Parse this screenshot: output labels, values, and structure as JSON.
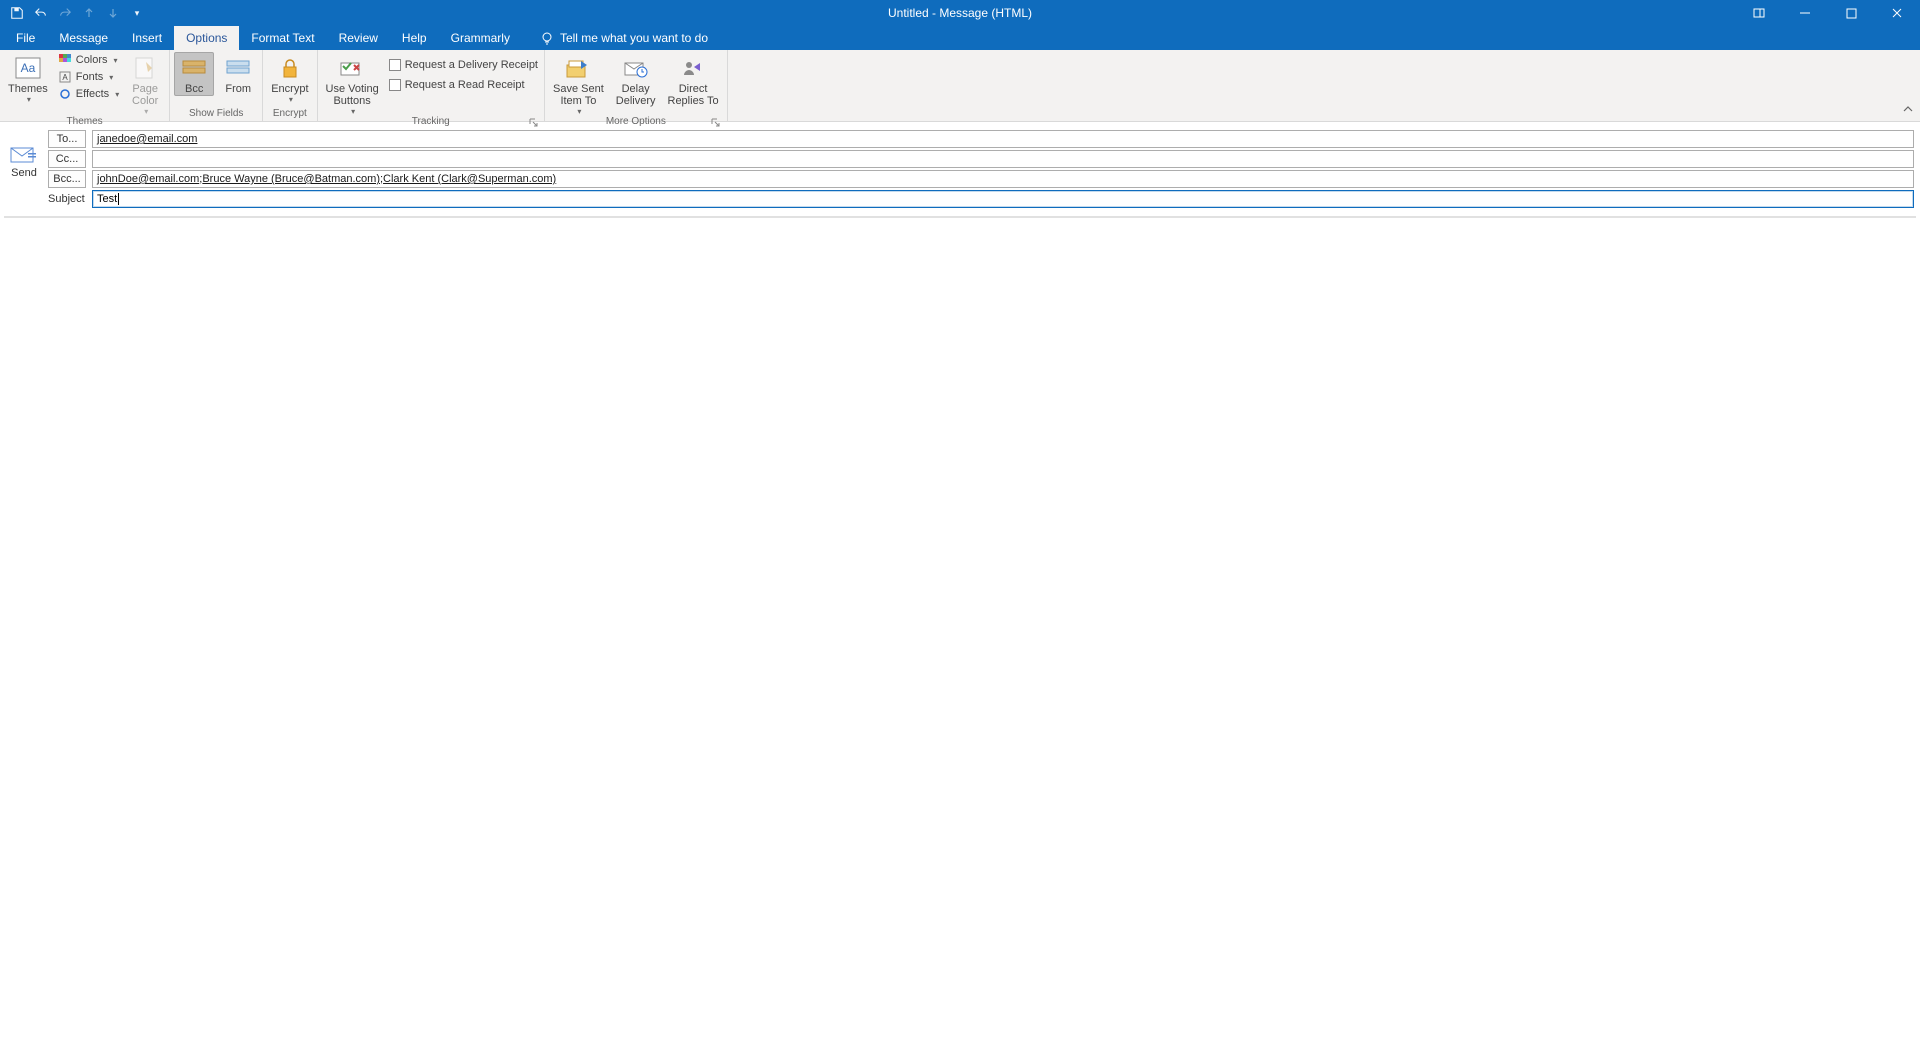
{
  "window": {
    "title": "Untitled  -  Message (HTML)"
  },
  "qat": {
    "save": "save",
    "undo": "undo",
    "redo": "redo",
    "prev": "prev",
    "next": "next"
  },
  "tabs": {
    "items": [
      "File",
      "Message",
      "Insert",
      "Options",
      "Format Text",
      "Review",
      "Help",
      "Grammarly"
    ],
    "active_index": 3,
    "tellme": "Tell me what you want to do"
  },
  "ribbon": {
    "themes": {
      "label": "Themes",
      "themes_btn": "Themes",
      "colors": "Colors",
      "fonts": "Fonts",
      "effects": "Effects",
      "page_color": "Page\nColor"
    },
    "show_fields": {
      "label": "Show Fields",
      "bcc": "Bcc",
      "from": "From"
    },
    "encrypt": {
      "label": "Encrypt",
      "encrypt": "Encrypt"
    },
    "tracking": {
      "label": "Tracking",
      "voting": "Use Voting\nButtons",
      "delivery": "Request a Delivery Receipt",
      "read": "Request a Read Receipt"
    },
    "more": {
      "label": "More Options",
      "save_sent": "Save Sent\nItem To",
      "delay": "Delay\nDelivery",
      "direct": "Direct\nReplies To"
    }
  },
  "compose": {
    "send": "Send",
    "to_label": "To...",
    "cc_label": "Cc...",
    "bcc_label": "Bcc...",
    "subject_label": "Subject",
    "to_value": "janedoe@email.com",
    "cc_value": "",
    "bcc_values": [
      "johnDoe@email.com",
      "Bruce Wayne (Bruce@Batman.com)",
      "Clark Kent (Clark@Superman.com)"
    ],
    "subject_value": "Test"
  }
}
